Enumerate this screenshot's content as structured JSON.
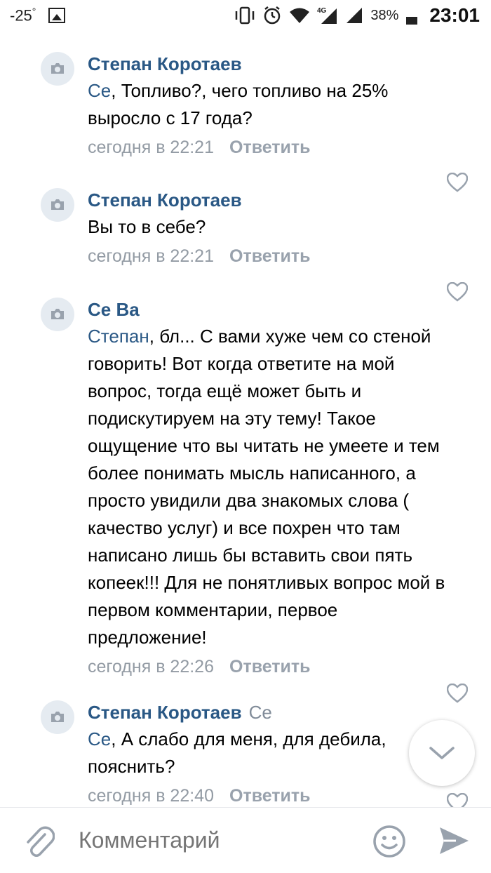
{
  "status_bar": {
    "temperature": "-25",
    "degree": "°",
    "battery": "38%",
    "time": "23:01",
    "signal": "4G"
  },
  "comments": [
    {
      "author": "Степан Коротаев",
      "reply_to": "",
      "mention": "Се",
      "text": ", Топливо?, чего топливо на 25% выросло с 17 года?",
      "time": "сегодня в 22:21",
      "reply_label": "Ответить"
    },
    {
      "author": "Степан Коротаев",
      "reply_to": "",
      "mention": "",
      "text": "Вы то в себе?",
      "time": "сегодня в 22:21",
      "reply_label": "Ответить"
    },
    {
      "author": "Се Ва",
      "reply_to": "",
      "mention": "Степан",
      "text": ", бл... С вами хуже чем со стеной говорить! Вот когда ответите на мой вопрос, тогда ещё может быть и подискутируем на эту тему! Такое ощущение что вы читать не умеете и тем более понимать мысль написанного, а просто увидили два знакомых слова ( качество услуг) и все похрен что там написано лишь бы вставить свои пять копеек!!! Для не понятливых вопрос мой в первом комментарии, первое предложение!",
      "time": "сегодня в 22:26",
      "reply_label": "Ответить"
    },
    {
      "author": "Степан Коротаев",
      "reply_to": "Се",
      "mention": "Се",
      "text": ", А слабо для меня, для дебила, пояснить?",
      "time": "сегодня в 22:40",
      "reply_label": "Ответить"
    }
  ],
  "composer": {
    "placeholder": "Комментарий"
  },
  "icons": {
    "attach": "paperclip-icon",
    "emoji": "smile-icon",
    "send": "send-icon",
    "like": "heart-icon",
    "scroll_down": "chevron-down-icon",
    "avatar": "camera-icon"
  },
  "colors": {
    "link": "#2a5885",
    "meta": "#939ba4",
    "avatar_bg": "#e5ebf1"
  }
}
